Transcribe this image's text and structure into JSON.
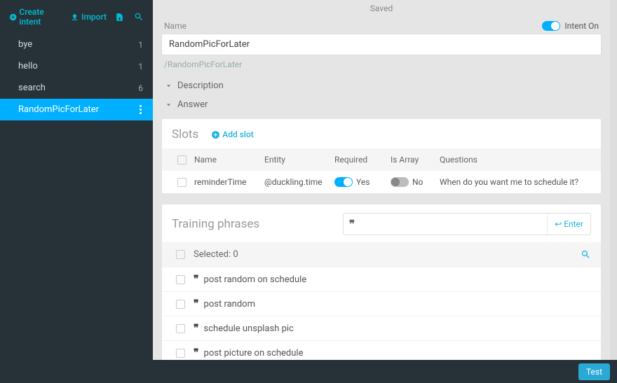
{
  "sidebar": {
    "create_label": "Create intent",
    "import_label": "Import",
    "intents": [
      {
        "name": "bye",
        "count": "1"
      },
      {
        "name": "hello",
        "count": "1"
      },
      {
        "name": "search",
        "count": "6"
      },
      {
        "name": "RandomPicForLater",
        "count": ""
      }
    ]
  },
  "main": {
    "saved": "Saved",
    "name_label": "Name",
    "intent_on_label": "Intent On",
    "name_value": "RandomPicForLater",
    "breadcrumb": "/RandomPicForLater",
    "desc_label": "Description",
    "answer_label": "Answer"
  },
  "slots": {
    "title": "Slots",
    "add_label": "Add slot",
    "headers": {
      "name": "Name",
      "entity": "Entity",
      "required": "Required",
      "isarray": "Is Array",
      "questions": "Questions"
    },
    "rows": [
      {
        "name": "reminderTime",
        "entity": "@duckling.time",
        "required": "Yes",
        "isarray": "No",
        "question": "When do you want me to schedule it?"
      }
    ]
  },
  "phrases": {
    "title": "Training phrases",
    "enter_label": "Enter",
    "selected_label": "Selected: 0",
    "items": [
      "post random on schedule",
      "post random",
      "schedule unsplash pic",
      "post picture on schedule"
    ]
  },
  "footer": {
    "test": "Test"
  }
}
